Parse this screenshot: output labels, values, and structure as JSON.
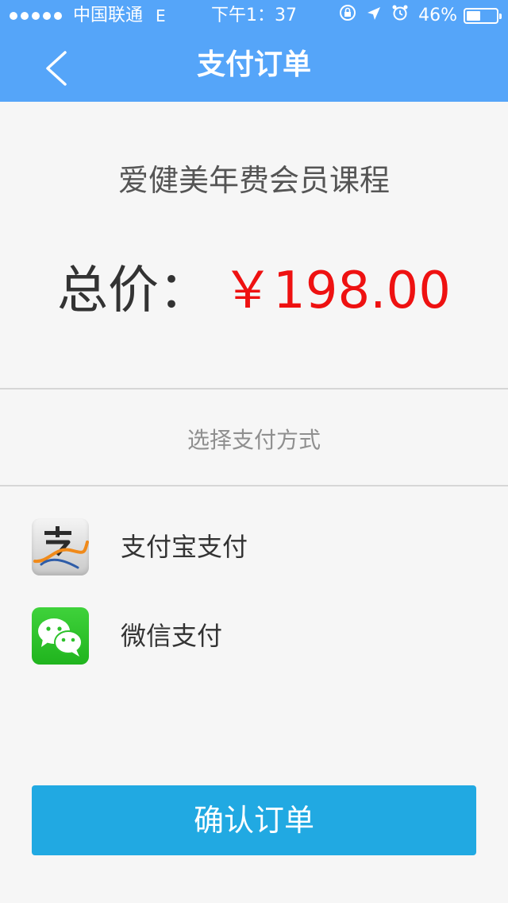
{
  "status_bar": {
    "carrier": "中国联通",
    "network": "E",
    "time": "下午1：37",
    "battery": "46%",
    "battery_level": 0.46
  },
  "header": {
    "title": "支付订单",
    "back_icon": "chevron-left-icon"
  },
  "product": {
    "title": "爱健美年费会员课程"
  },
  "price": {
    "label": "总价：",
    "value": "￥198.00",
    "value_color": "#ee1111"
  },
  "payment": {
    "section_label": "选择支付方式",
    "options": [
      {
        "label": "支付宝支付",
        "icon": "alipay-icon"
      },
      {
        "label": "微信支付",
        "icon": "wechat-icon"
      }
    ]
  },
  "confirm": {
    "label": "确认订单"
  },
  "colors": {
    "header_bg": "#55a5f9",
    "confirm_bg": "#21a9e2",
    "page_bg": "#f6f6f6"
  }
}
